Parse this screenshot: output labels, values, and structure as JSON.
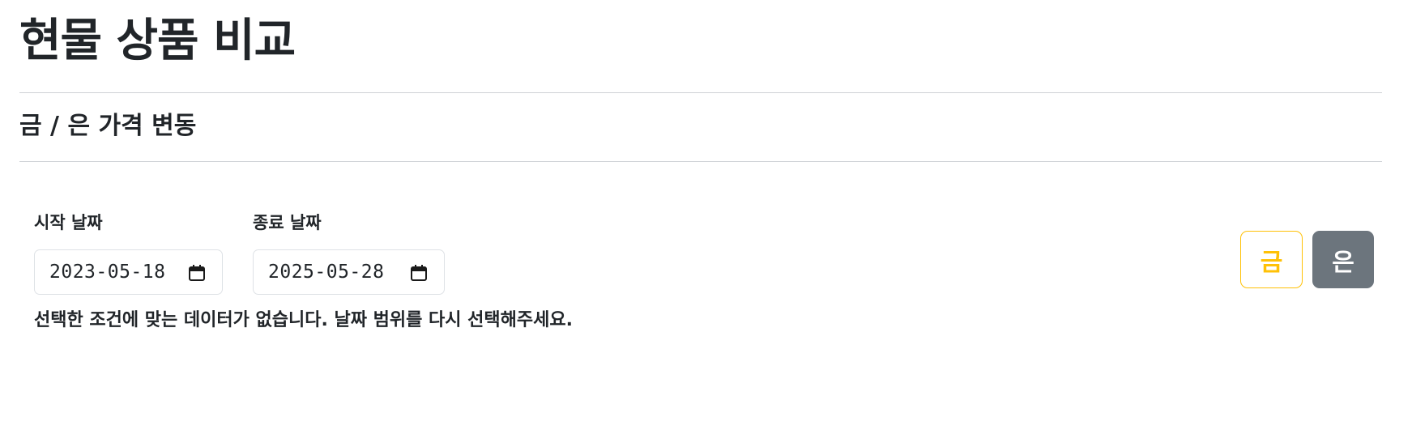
{
  "page": {
    "title": "현물 상품 비교"
  },
  "section": {
    "title": "금 / 은 가격 변동"
  },
  "filters": {
    "start_date": {
      "label": "시작 날짜",
      "value": "2023-05-18",
      "icon": "calendar-icon"
    },
    "end_date": {
      "label": "종료 날짜",
      "value": "2025-05-28",
      "icon": "calendar-icon"
    }
  },
  "message": {
    "empty": "선택한 조건에 맞는 데이터가 없습니다. 날짜 범위를 다시 선택해주세요."
  },
  "toggles": {
    "gold": {
      "label": "금",
      "color": "#ffc107",
      "style": "outline"
    },
    "silver": {
      "label": "은",
      "color": "#6c757d",
      "style": "solid"
    }
  }
}
